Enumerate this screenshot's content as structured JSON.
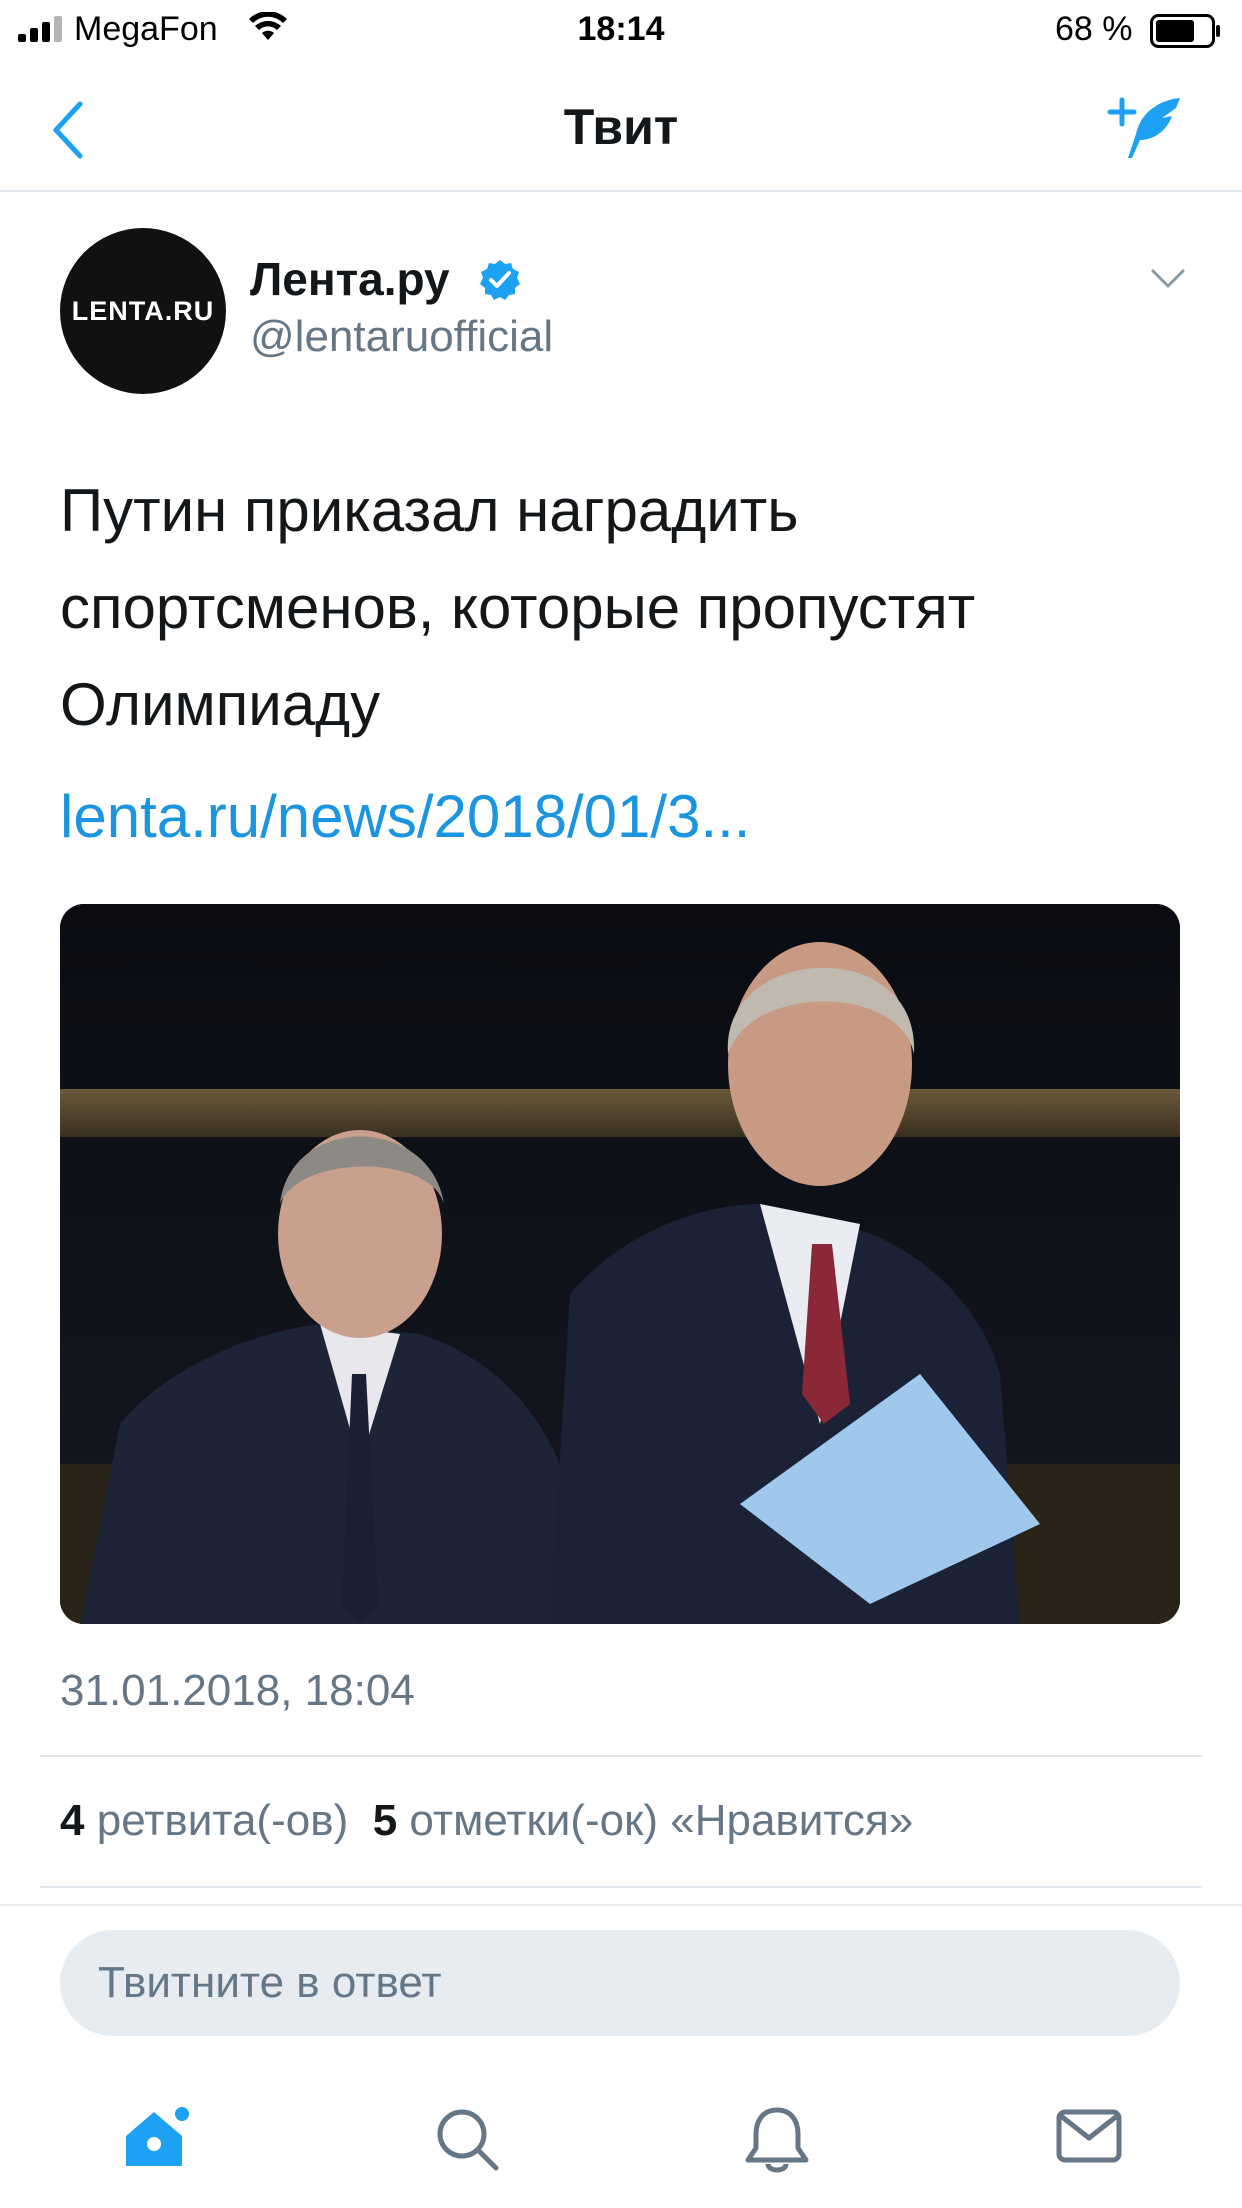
{
  "status_bar": {
    "carrier": "MegaFon",
    "time": "18:14",
    "battery_percent": "68 %"
  },
  "nav": {
    "title": "Твит"
  },
  "tweet": {
    "author_name": "Лента.ру",
    "author_handle": "@lentaruofficial",
    "avatar_text": "LENTA.RU",
    "text": "Путин приказал наградить спортсменов, которые пропустят Олимпиаду",
    "link": "lenta.ru/news/2018/01/3...",
    "date": "31.01.2018, 18:04",
    "retweet_count": "4",
    "retweet_label": "ретвита(-ов)",
    "like_count": "5",
    "like_label": "отметки(-ок) «Нравится»"
  },
  "reply": {
    "placeholder": "Твитните в ответ"
  },
  "tab_bar": {
    "items": [
      "home-icon",
      "search-icon",
      "notifications-icon",
      "messages-icon"
    ]
  },
  "colors": {
    "accent": "#1da1f2",
    "link": "#1b95e0",
    "secondary_text": "#657786"
  }
}
